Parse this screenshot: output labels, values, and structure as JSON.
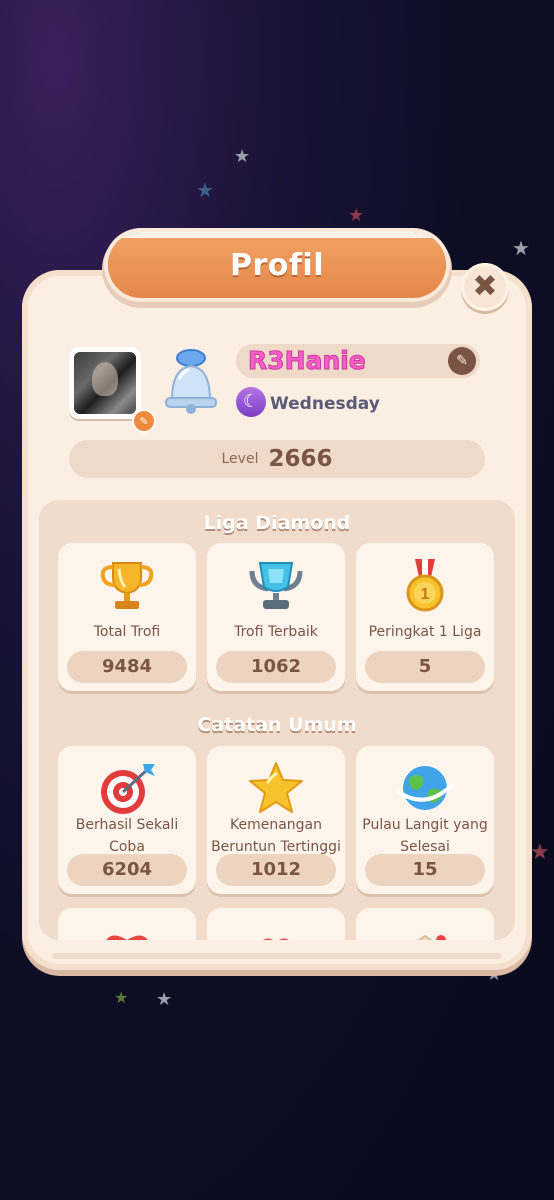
{
  "header": {
    "title": "Profil",
    "close_symbol": "✖"
  },
  "profile": {
    "username": "R3Hanie",
    "title": "Wednesday",
    "level_label": "Level",
    "level_value": "2666"
  },
  "league": {
    "section_title": "Liga Diamond",
    "cards": [
      {
        "label": "Total Trofi",
        "value": "9484",
        "icon": "gold-trophy-icon"
      },
      {
        "label": "Trofi Terbaik",
        "value": "1062",
        "icon": "diamond-trophy-icon"
      },
      {
        "label": "Peringkat 1 Liga",
        "value": "5",
        "icon": "gold-medal-icon"
      }
    ]
  },
  "general": {
    "section_title": "Catatan Umum",
    "cards": [
      {
        "label": "Berhasil Sekali Coba",
        "value": "6204",
        "icon": "target-icon"
      },
      {
        "label": "Kemenangan Beruntun Tertinggi",
        "value": "1012",
        "icon": "star-icon"
      },
      {
        "label": "Pulau Langit yang Selesai",
        "value": "15",
        "icon": "globe-icon"
      }
    ]
  },
  "colors": {
    "panel": "#fbeee2",
    "banner": "#e4884a",
    "username": "#ff5ec8",
    "text_brown": "#7a5545"
  }
}
